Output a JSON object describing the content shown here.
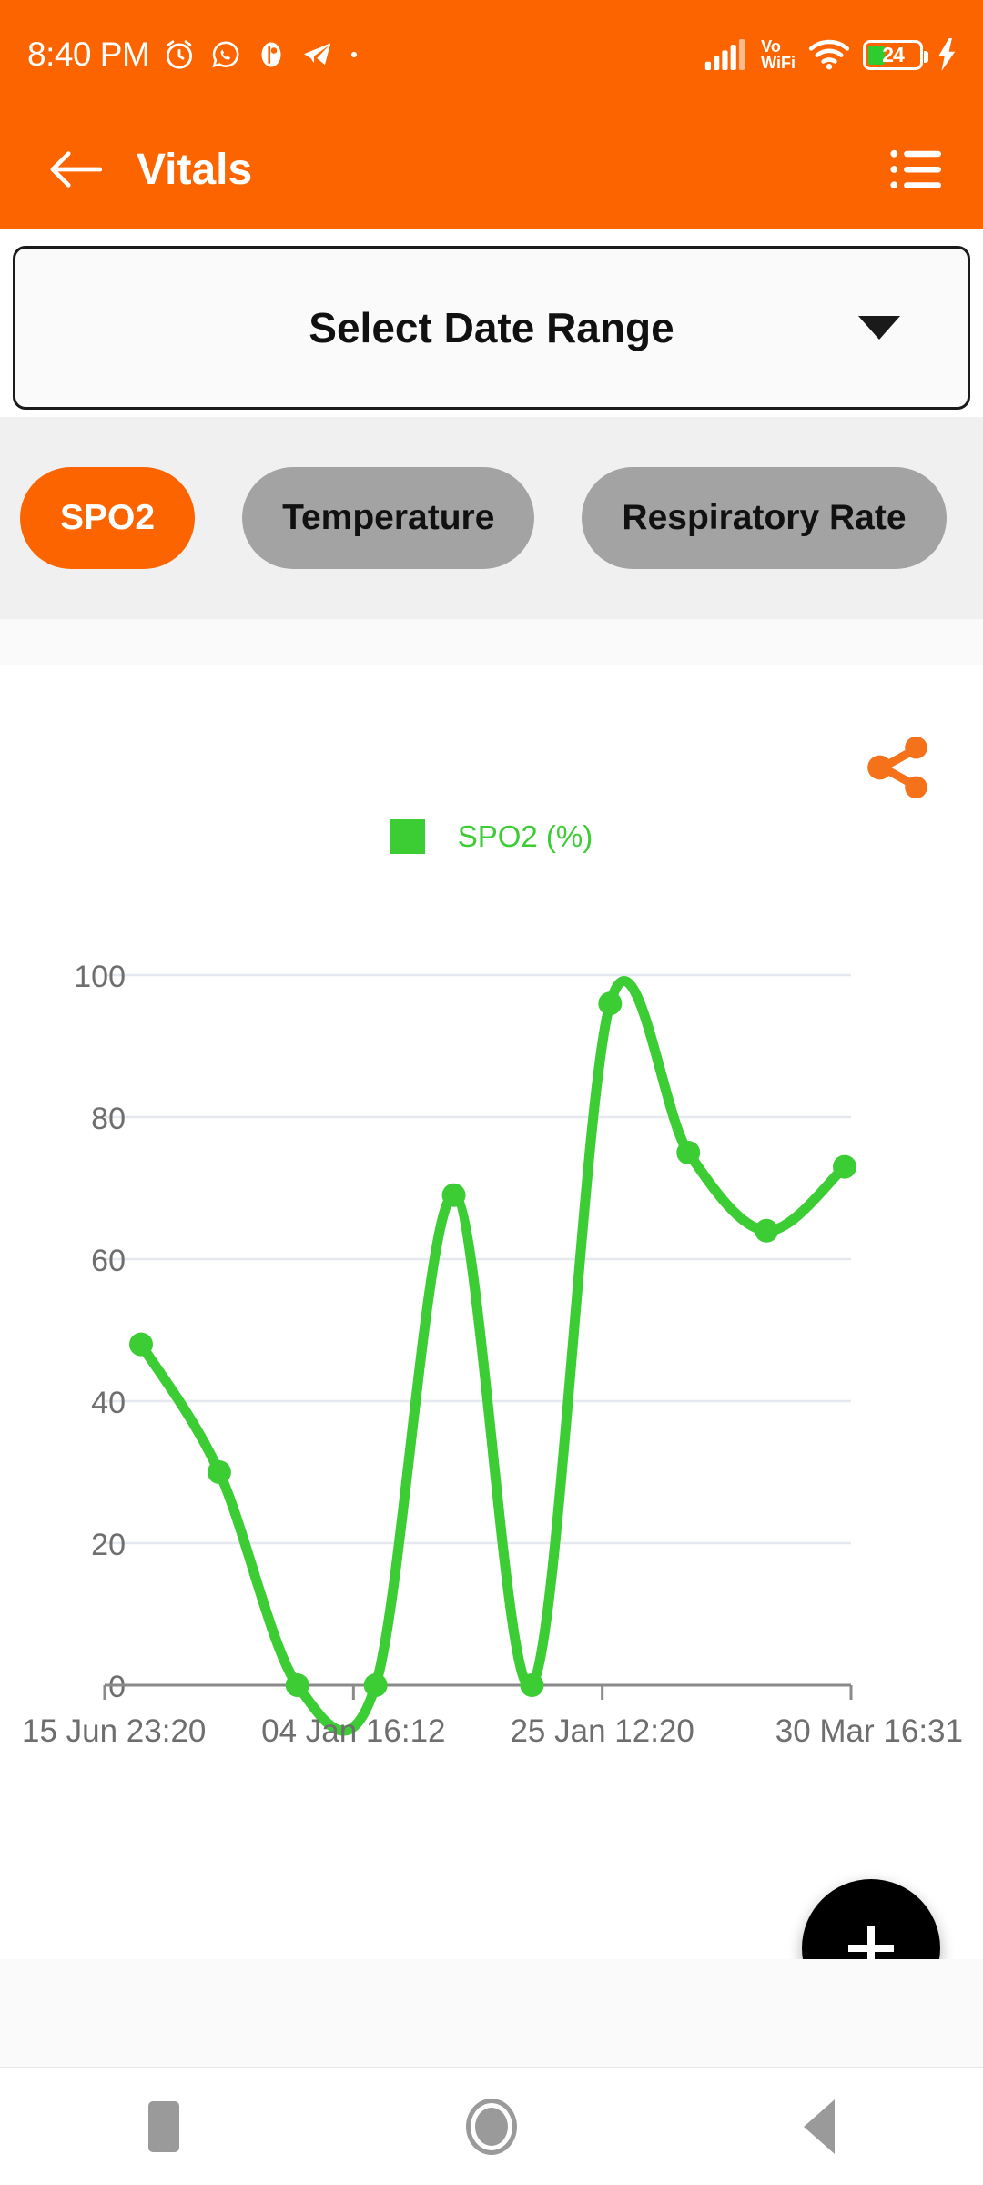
{
  "statusbar": {
    "time": "8:40 PM",
    "left_icons": [
      "alarm-icon",
      "whatsapp-icon",
      "app-badge-icon",
      "telegram-icon",
      "dot-icon"
    ],
    "network_label_line1": "Vo",
    "network_label_line2": "WiFi",
    "battery_percent": "24",
    "right_icons": [
      "signal-icon",
      "vowifi-icon",
      "wifi-icon",
      "battery-icon",
      "charging-bolt-icon"
    ]
  },
  "appbar": {
    "back_icon": "arrow-left-icon",
    "title": "Vitals",
    "menu_icon": "list-menu-icon",
    "bg_color": "#FC6400"
  },
  "date_range": {
    "label": "Select Date Range",
    "caret_icon": "chevron-down-icon"
  },
  "chips": [
    {
      "label": "SPO2",
      "selected": true
    },
    {
      "label": "Temperature",
      "selected": false
    },
    {
      "label": "Respiratory Rate",
      "selected": false
    }
  ],
  "chart_card": {
    "share_icon": "share-icon",
    "share_color": "#F5711A"
  },
  "fab": {
    "icon": "plus-icon",
    "color": "#000000"
  },
  "navbar": {
    "items": [
      {
        "icon": "recents-square-icon"
      },
      {
        "icon": "home-circle-icon"
      },
      {
        "icon": "back-triangle-icon"
      }
    ]
  },
  "chart_data": {
    "type": "line",
    "title": "",
    "xlabel": "",
    "ylabel": "",
    "legend": [
      {
        "name": "SPO2 (%)",
        "color": "#3CCD35"
      }
    ],
    "legend_position": "top-center",
    "grid": true,
    "ylim": [
      0,
      100
    ],
    "yticks": [
      0,
      20,
      40,
      60,
      80,
      100
    ],
    "ytick_labels": [
      "0",
      "20",
      "40",
      "60",
      "80",
      "100"
    ],
    "xtick_labels": [
      "15 Jun 23:20",
      "04 Jan 16:12",
      "25 Jan 12:20",
      "30 Mar 16:31"
    ],
    "line_color": "#3CCD35",
    "marker_color": "#3CCD35",
    "smoothing": "spline",
    "series": [
      {
        "name": "SPO2 (%)",
        "values": [
          48,
          30,
          0,
          0,
          69,
          0,
          96,
          75,
          64,
          73
        ]
      }
    ],
    "points": [
      {
        "index": 0,
        "value": 48
      },
      {
        "index": 1,
        "value": 30
      },
      {
        "index": 2,
        "value": 0
      },
      {
        "index": 3,
        "value": 0
      },
      {
        "index": 4,
        "value": 69
      },
      {
        "index": 5,
        "value": 0
      },
      {
        "index": 6,
        "value": 96
      },
      {
        "index": 7,
        "value": 75
      },
      {
        "index": 8,
        "value": 64
      },
      {
        "index": 9,
        "value": 73
      }
    ]
  }
}
